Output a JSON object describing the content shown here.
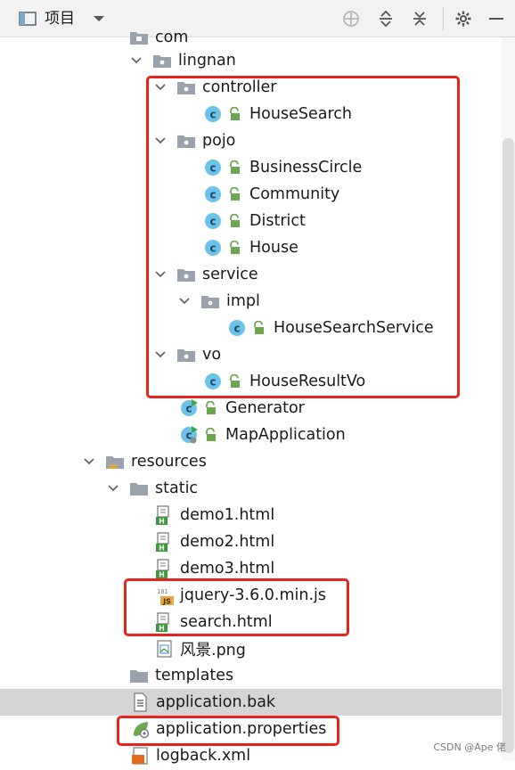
{
  "toolbar": {
    "title": "项目",
    "icons": [
      "project-view-icon",
      "dropdown-icon",
      "locate-icon",
      "expand-all-icon",
      "collapse-all-icon",
      "gear-icon",
      "minimize-icon"
    ]
  },
  "tree": {
    "items": [
      {
        "label": "com"
      },
      {
        "label": "lingnan"
      },
      {
        "label": "controller"
      },
      {
        "label": "HouseSearch"
      },
      {
        "label": "pojo"
      },
      {
        "label": "BusinessCircle"
      },
      {
        "label": "Community"
      },
      {
        "label": "District"
      },
      {
        "label": "House"
      },
      {
        "label": "service"
      },
      {
        "label": "impl"
      },
      {
        "label": "HouseSearchService"
      },
      {
        "label": "vo"
      },
      {
        "label": "HouseResultVo"
      },
      {
        "label": "Generator"
      },
      {
        "label": "MapApplication"
      },
      {
        "label": "resources"
      },
      {
        "label": "static"
      },
      {
        "label": "demo1.html"
      },
      {
        "label": "demo2.html"
      },
      {
        "label": "demo3.html"
      },
      {
        "label": "jquery-3.6.0.min.js"
      },
      {
        "label": "search.html"
      },
      {
        "label": "风景.png"
      },
      {
        "label": "templates"
      },
      {
        "label": "application.bak"
      },
      {
        "label": "application.properties"
      },
      {
        "label": "logback.xml"
      }
    ]
  },
  "colors": {
    "highlight": "#e8231a",
    "class_icon": "#6cc2e8",
    "lock": "#6aa84f",
    "folder": "#9aa3ad",
    "selection": "#d5d5d5"
  },
  "watermark": "CSDN @Ape 佬"
}
